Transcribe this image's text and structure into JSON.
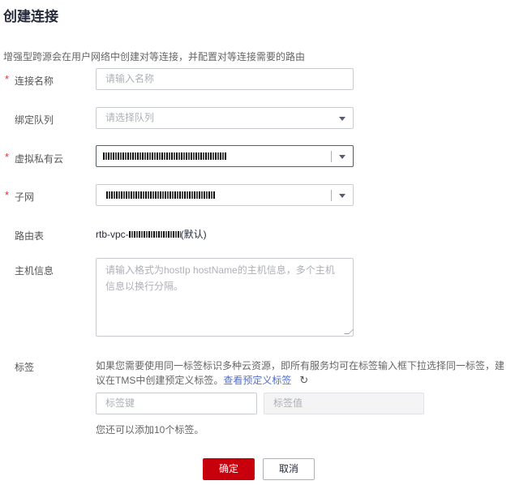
{
  "title": "创建连接",
  "description": "增强型跨源会在用户网络中创建对等连接，并配置对等连接需要的路由",
  "form": {
    "name": {
      "label": "连接名称",
      "required": "*",
      "placeholder": "请输入名称"
    },
    "queue": {
      "label": "绑定队列",
      "placeholder": "请选择队列"
    },
    "vpc": {
      "label": "虚拟私有云",
      "required": "*"
    },
    "subnet": {
      "label": "子网",
      "required": "*"
    },
    "route": {
      "label": "路由表",
      "prefix": "rtb-vpc-",
      "suffix": "(默认)"
    },
    "host": {
      "label": "主机信息",
      "placeholder": "请输入格式为hostIp hostName的主机信息，多个主机信息以换行分隔。"
    },
    "tags": {
      "label": "标签",
      "hint": "如果您需要使用同一标签标识多种云资源，即所有服务均可在标签输入框下拉选择同一标签，建议在TMS中创建预定义标签。",
      "link": "查看预定义标签",
      "key_placeholder": "标签键",
      "value_placeholder": "标签值",
      "note": "您还可以添加10个标签。"
    }
  },
  "buttons": {
    "confirm": "确定",
    "cancel": "取消"
  },
  "colors": {
    "primary": "#c7000b",
    "link": "#526ecc",
    "required": "#e0312e"
  }
}
